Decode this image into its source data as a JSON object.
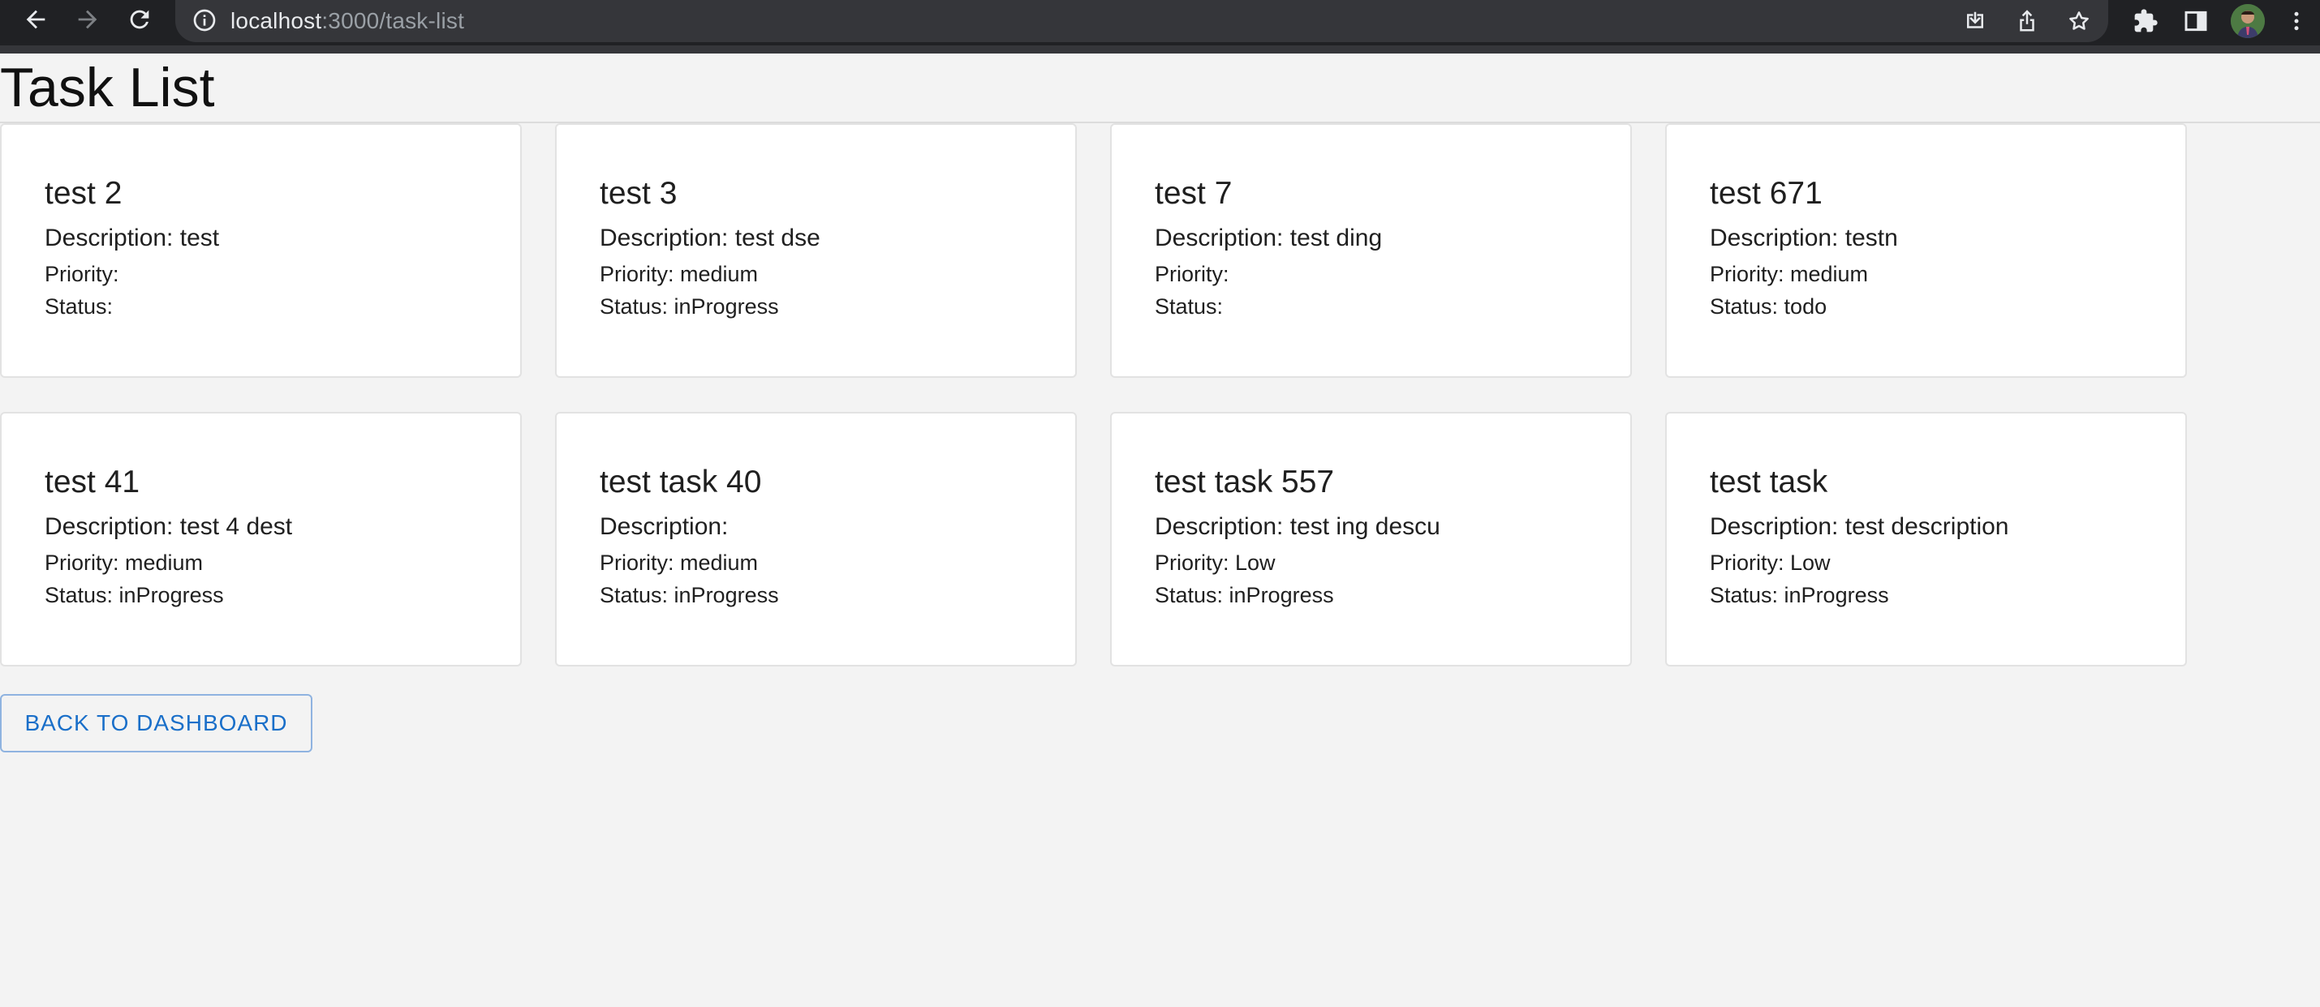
{
  "browser": {
    "url_host": "localhost",
    "url_path": ":3000/task-list",
    "icons": [
      "back-icon",
      "forward-icon",
      "reload-icon",
      "info-icon",
      "install-icon",
      "share-icon",
      "bookmark-star-icon",
      "extensions-icon",
      "side-panel-icon",
      "profile-avatar",
      "menu-icon"
    ]
  },
  "page": {
    "title": "Task List"
  },
  "tasks": [
    {
      "title": "test 2",
      "description": "Description: test",
      "priority": "Priority: ",
      "status": "Status: "
    },
    {
      "title": "test 3",
      "description": "Description: test dse",
      "priority": "Priority: medium",
      "status": "Status: inProgress"
    },
    {
      "title": "test 7",
      "description": "Description: test ding",
      "priority": "Priority: ",
      "status": "Status: "
    },
    {
      "title": "test 671",
      "description": "Description: testn",
      "priority": "Priority: medium",
      "status": "Status: todo"
    },
    {
      "title": "test 41",
      "description": "Description: test 4 dest",
      "priority": "Priority: medium",
      "status": "Status: inProgress"
    },
    {
      "title": "test task 40",
      "description": "Description: ",
      "priority": "Priority: medium",
      "status": "Status: inProgress"
    },
    {
      "title": "test task 557",
      "description": "Description: test ing descu",
      "priority": "Priority: Low",
      "status": "Status: inProgress"
    },
    {
      "title": "test task",
      "description": "Description: test description",
      "priority": "Priority: Low",
      "status": "Status: inProgress"
    }
  ],
  "actions": {
    "back_label": "BACK TO DASHBOARD"
  },
  "colors": {
    "accent": "#1a6fc9",
    "background": "#f3f3f3",
    "card": "#ffffff"
  }
}
